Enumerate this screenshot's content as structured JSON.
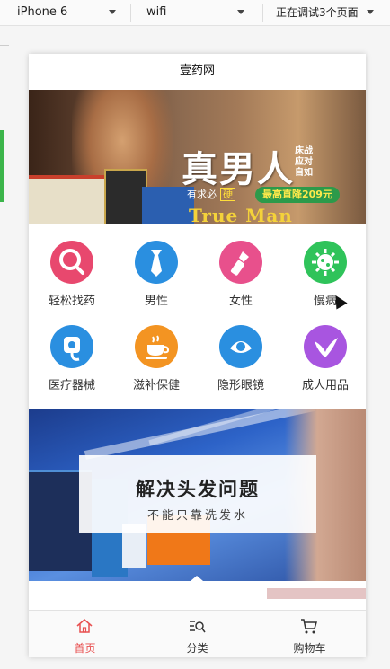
{
  "toolbar": {
    "device": "iPhone 6",
    "network": "wifi",
    "status": "正在调试3个页面"
  },
  "page": {
    "title": "壹药网"
  },
  "banner_top": {
    "headline": "真男人",
    "side_lines": [
      "床战",
      "应对",
      "自如"
    ],
    "line_prefix": "有求必",
    "line_emphasis": "硬",
    "badge": "最高直降209元",
    "english": "True Man"
  },
  "categories": [
    {
      "label": "轻松找药",
      "icon": "search-icon",
      "color": "#e8486e"
    },
    {
      "label": "男性",
      "icon": "tie-icon",
      "color": "#2a8fe0"
    },
    {
      "label": "女性",
      "icon": "lipstick-icon",
      "color": "#e8508c"
    },
    {
      "label": "慢病",
      "icon": "virus-icon",
      "color": "#2fc35a"
    },
    {
      "label": "医疗器械",
      "icon": "medical-device-icon",
      "color": "#2a8fe0"
    },
    {
      "label": "滋补保健",
      "icon": "teacup-icon",
      "color": "#f39422"
    },
    {
      "label": "隐形眼镜",
      "icon": "contact-lens-icon",
      "color": "#2a8fe0"
    },
    {
      "label": "成人用品",
      "icon": "bird-icon",
      "color": "#a855e0"
    }
  ],
  "banner_mid": {
    "title": "解决头发问题",
    "subtitle": "不能只靠洗发水"
  },
  "tabbar": {
    "items": [
      {
        "label": "首页",
        "icon": "home-icon",
        "active": true,
        "color": "#e85050"
      },
      {
        "label": "分类",
        "icon": "category-search-icon",
        "active": false,
        "color": "#333333"
      },
      {
        "label": "购物车",
        "icon": "cart-icon",
        "active": false,
        "color": "#333333"
      }
    ]
  }
}
